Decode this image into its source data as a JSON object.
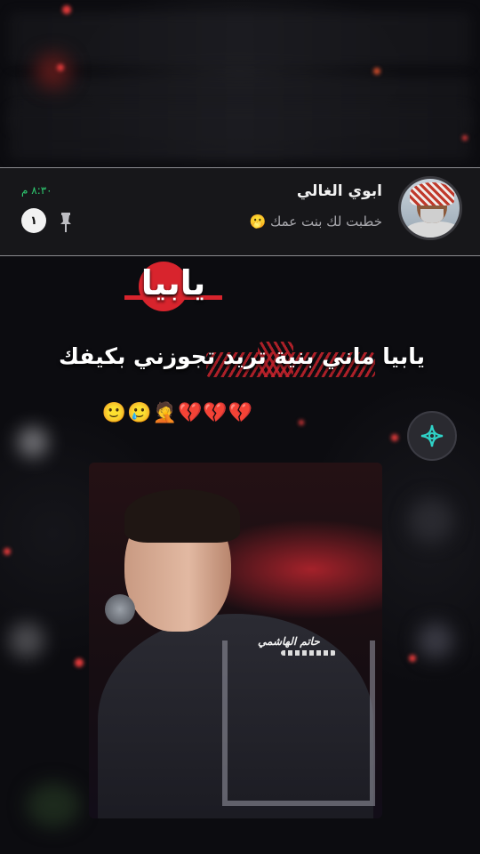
{
  "notification": {
    "sender_name": "ابوي الغالي",
    "message_preview": "خطبت لك بنت عمك 🫢",
    "time": "٨:٣٠ م",
    "unread_count": "١",
    "avatar_icon": "profile-photo-icon",
    "pin_icon": "pin-icon"
  },
  "overlay": {
    "title": "يابيا",
    "lyric": "يابيا ماني بنية تريد تجوزني بكيفك",
    "emojis": "💔💔💔🤦🥲🙂",
    "watermark": "حاتم الهاشمي",
    "accent_color": "#d8242d"
  },
  "floating_button": {
    "icon": "sparkle-plus-icon"
  }
}
